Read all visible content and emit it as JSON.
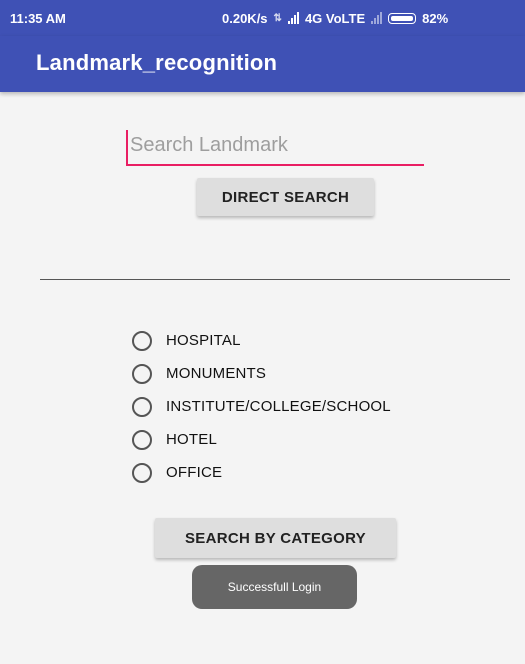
{
  "status_bar": {
    "time": "11:35 AM",
    "net_speed": "0.20K/s",
    "network": "4G VoLTE",
    "battery": "82%"
  },
  "app_bar": {
    "title": "Landmark_recognition"
  },
  "search": {
    "placeholder": "Search Landmark",
    "value": ""
  },
  "buttons": {
    "direct_search": "DIRECT SEARCH",
    "search_by_category": "SEARCH BY CATEGORY"
  },
  "categories": [
    {
      "label": "HOSPITAL",
      "checked": false
    },
    {
      "label": "MONUMENTS",
      "checked": false
    },
    {
      "label": "INSTITUTE/COLLEGE/SCHOOL",
      "checked": false
    },
    {
      "label": "HOTEL",
      "checked": false
    },
    {
      "label": "OFFICE",
      "checked": false
    }
  ],
  "toast": {
    "message": "Successfull Login"
  },
  "colors": {
    "primary": "#3f51b5",
    "accent": "#e91e63",
    "button": "#dedede",
    "toast": "#666666"
  }
}
